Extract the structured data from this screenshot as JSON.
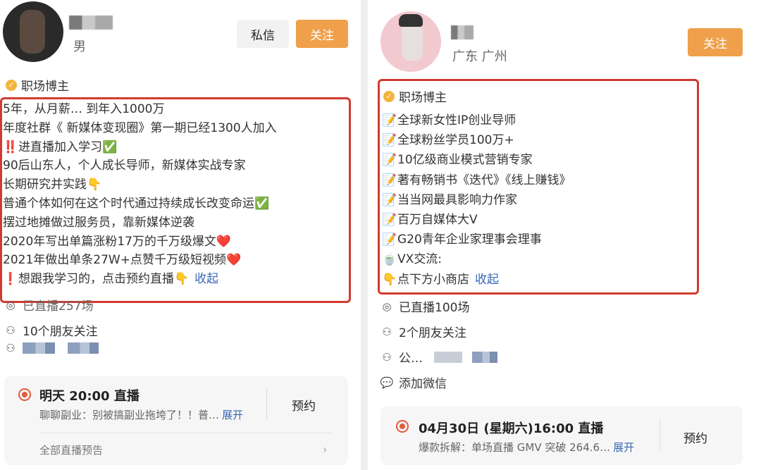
{
  "left": {
    "gender": "男",
    "buttons": {
      "message": "私信",
      "follow": "关注"
    },
    "verified_label": "职场博主",
    "bio_lines": [
      {
        "icon": "",
        "text": "5年，从月薪…   到年入1000万"
      },
      {
        "icon": "",
        "text": "年度社群《      新媒体变现圈》第一期已经1300人加入"
      },
      {
        "icon": "‼️",
        "text": "进直播加入学习✅"
      },
      {
        "icon": "",
        "text": "90后山东人，个人成长导师，新媒体实战专家"
      },
      {
        "icon": "",
        "text": "长期研究并实践👇"
      },
      {
        "icon": "",
        "text": "普通个体如何在这个时代通过持续成长改变命运✅"
      },
      {
        "icon": "",
        "text": "摆过地摊做过服务员，靠新媒体逆袭"
      },
      {
        "icon": "",
        "text": "2020年写出单篇涨粉17万的千万级爆文❤️"
      },
      {
        "icon": "",
        "text": "2021年做出单条27W+点赞千万级短视频❤️"
      },
      {
        "icon": "❗",
        "text": "想跟我学习的，点击预约直播👇"
      }
    ],
    "collapse": "收起",
    "live_count": "已直播257场",
    "friends_follow": "10个朋友关注",
    "live_card": {
      "title": "明天 20:00 直播",
      "desc": "聊聊副业：别被搞副业拖垮了！！普…",
      "expand": "展开",
      "reserve": "预约",
      "all": "全部直播预告"
    }
  },
  "right": {
    "location": "广东 广州",
    "buttons": {
      "follow": "关注"
    },
    "verified_label": "职场博主",
    "bio_lines": [
      {
        "icon": "📝",
        "text": "全球新女性IP创业导师"
      },
      {
        "icon": "📝",
        "text": "全球粉丝学员100万+"
      },
      {
        "icon": "📝",
        "text": "10亿级商业模式营销专家"
      },
      {
        "icon": "📝",
        "text": "著有畅销书《迭代》《线上赚钱》"
      },
      {
        "icon": "📝",
        "text": "当当网最具影响力作家"
      },
      {
        "icon": "📝",
        "text": "百万自媒体大V"
      },
      {
        "icon": "📝",
        "text": "G20青年企业家理事会理事"
      },
      {
        "icon": "🍵",
        "text": "VX交流:"
      },
      {
        "icon": "👇",
        "text": "点下方小商店"
      }
    ],
    "collapse": "收起",
    "live_count": "已直播100场",
    "friends_follow": "2个朋友关注",
    "company": "公…",
    "wechat": "添加微信",
    "live_card": {
      "title": "04月30日 (星期六)16:00 直播",
      "desc": "爆款拆解：单场直播 GMV 突破 264.6…",
      "expand": "展开",
      "reserve": "预约"
    }
  },
  "colors": {
    "follow": "#f0a04b",
    "highlight_border": "#d33a2f",
    "link": "#3a67b6",
    "live": "#e55a3c"
  }
}
